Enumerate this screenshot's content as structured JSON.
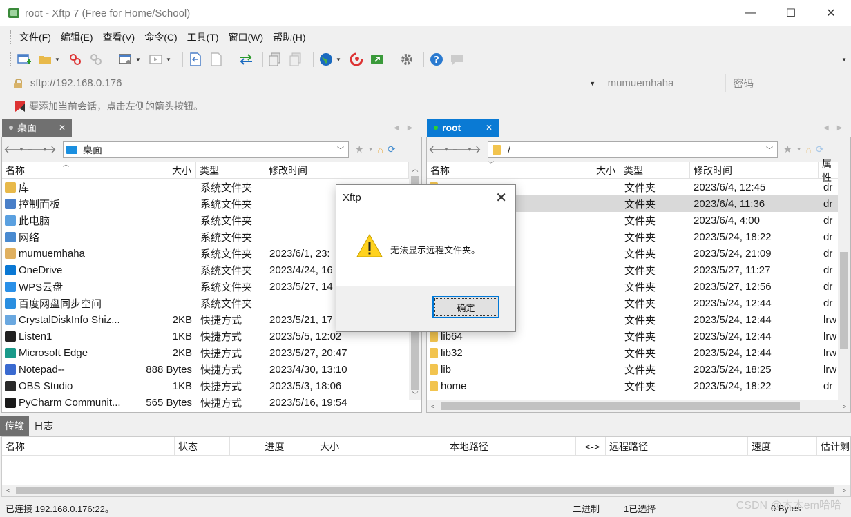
{
  "window": {
    "title": "root - Xftp 7 (Free for Home/School)",
    "minimize": "—",
    "maximize": "☐",
    "close": "✕"
  },
  "menu": [
    "文件(F)",
    "编辑(E)",
    "查看(V)",
    "命令(C)",
    "工具(T)",
    "窗口(W)",
    "帮助(H)"
  ],
  "toolbar_icons": [
    "new-session-icon",
    "open-folder-icon",
    "disconnect-icon",
    "reconnect-icon",
    "new-window-icon",
    "view-icon",
    "upload-icon",
    "download-icon",
    "transfer-icon",
    "copy-icon",
    "paste-icon",
    "globe-icon",
    "xshell-icon",
    "xftp-icon",
    "settings-icon",
    "help-icon",
    "chat-icon"
  ],
  "address": {
    "url": "sftp://192.168.0.176",
    "user_placeholder": "mumuemhaha",
    "password_placeholder": "密码"
  },
  "hint": "要添加当前会话，点击左侧的箭头按钮。",
  "local": {
    "tab": "桌面",
    "path": "桌面",
    "columns": [
      "名称",
      "大小",
      "类型",
      "修改时间"
    ],
    "rows": [
      {
        "name": "库",
        "size": "",
        "type": "系统文件夹",
        "modified": "",
        "icon_color": "#e8b94a"
      },
      {
        "name": "控制面板",
        "size": "",
        "type": "系统文件夹",
        "modified": "",
        "icon_color": "#4a7fc8"
      },
      {
        "name": "此电脑",
        "size": "",
        "type": "系统文件夹",
        "modified": "",
        "icon_color": "#5aa0e0"
      },
      {
        "name": "网络",
        "size": "",
        "type": "系统文件夹",
        "modified": "",
        "icon_color": "#4a8ad0"
      },
      {
        "name": "mumuemhaha",
        "size": "",
        "type": "系统文件夹",
        "modified": "2023/6/1, 23:",
        "icon_color": "#e0b060"
      },
      {
        "name": "OneDrive",
        "size": "",
        "type": "系统文件夹",
        "modified": "2023/4/24, 16",
        "icon_color": "#0a78d4"
      },
      {
        "name": "WPS云盘",
        "size": "",
        "type": "系统文件夹",
        "modified": "2023/5/27, 14",
        "icon_color": "#2a90e8"
      },
      {
        "name": "百度网盘同步空间",
        "size": "",
        "type": "系统文件夹",
        "modified": "",
        "icon_color": "#2a8ee0"
      },
      {
        "name": "CrystalDiskInfo Shiz...",
        "size": "2KB",
        "type": "快捷方式",
        "modified": "2023/5/21, 17",
        "icon_color": "#6aa8e0"
      },
      {
        "name": "Listen1",
        "size": "1KB",
        "type": "快捷方式",
        "modified": "2023/5/5, 12:02",
        "icon_color": "#222222"
      },
      {
        "name": "Microsoft Edge",
        "size": "2KB",
        "type": "快捷方式",
        "modified": "2023/5/27, 20:47",
        "icon_color": "#1a9a8a"
      },
      {
        "name": "Notepad--",
        "size": "888 Bytes",
        "type": "快捷方式",
        "modified": "2023/4/30, 13:10",
        "icon_color": "#3a6ad0"
      },
      {
        "name": "OBS Studio",
        "size": "1KB",
        "type": "快捷方式",
        "modified": "2023/5/3, 18:06",
        "icon_color": "#2a2a2a"
      },
      {
        "name": "PyCharm Communit...",
        "size": "565 Bytes",
        "type": "快捷方式",
        "modified": "2023/5/16, 19:54",
        "icon_color": "#1a1a1a"
      }
    ]
  },
  "remote": {
    "tab": "root",
    "path": "/",
    "columns": [
      "名称",
      "大小",
      "类型",
      "修改时间",
      "属性"
    ],
    "rows": [
      {
        "name": "",
        "type": "文件夹",
        "modified": "2023/6/4, 12:45",
        "attr": "dr"
      },
      {
        "name": "",
        "type": "文件夹",
        "modified": "2023/6/4, 11:36",
        "attr": "dr"
      },
      {
        "name": "",
        "type": "文件夹",
        "modified": "2023/6/4, 4:00",
        "attr": "dr"
      },
      {
        "name": "",
        "type": "文件夹",
        "modified": "2023/5/24, 18:22",
        "attr": "dr"
      },
      {
        "name": "",
        "type": "文件夹",
        "modified": "2023/5/24, 21:09",
        "attr": "dr"
      },
      {
        "name": "",
        "type": "文件夹",
        "modified": "2023/5/27, 11:27",
        "attr": "dr"
      },
      {
        "name": "",
        "type": "文件夹",
        "modified": "2023/5/27, 12:56",
        "attr": "dr"
      },
      {
        "name": "",
        "type": "文件夹",
        "modified": "2023/5/24, 12:44",
        "attr": "dr"
      },
      {
        "name": "",
        "type": "文件夹",
        "modified": "2023/5/24, 12:44",
        "attr": "lrw"
      },
      {
        "name": "lib64",
        "type": "文件夹",
        "modified": "2023/5/24, 12:44",
        "attr": "lrw"
      },
      {
        "name": "lib32",
        "type": "文件夹",
        "modified": "2023/5/24, 12:44",
        "attr": "lrw"
      },
      {
        "name": "lib",
        "type": "文件夹",
        "modified": "2023/5/24, 18:25",
        "attr": "lrw"
      },
      {
        "name": "home",
        "type": "文件夹",
        "modified": "2023/5/24, 18:22",
        "attr": "dr"
      }
    ]
  },
  "bottom_tabs": [
    "传输",
    "日志"
  ],
  "transfer_columns": [
    "名称",
    "状态",
    "进度",
    "大小",
    "本地路径",
    "<->",
    "远程路径",
    "速度",
    "估计剩"
  ],
  "status": {
    "connection": "已连接 192.168.0.176:22。",
    "mode": "二进制",
    "selection": "1已选择",
    "size": "0 Bytes"
  },
  "watermark": "CSDN @木木em哈哈",
  "dialog": {
    "title": "Xftp",
    "message": "无法显示远程文件夹。",
    "ok": "确定"
  }
}
